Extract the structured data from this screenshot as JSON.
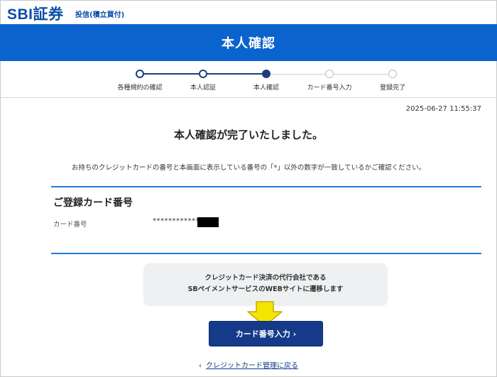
{
  "header": {
    "logo": "SBI証券",
    "subtitle": "投信(積立買付)"
  },
  "page_title": "本人確認",
  "stepper": {
    "steps": [
      {
        "label": "各種規約の確認",
        "state": "done"
      },
      {
        "label": "本人認証",
        "state": "done"
      },
      {
        "label": "本人確認",
        "state": "current"
      },
      {
        "label": "カード番号入力",
        "state": "todo"
      },
      {
        "label": "登録完了",
        "state": "todo"
      }
    ]
  },
  "timestamp": "2025-06-27 11:55:37",
  "main": {
    "heading": "本人確認が完了いたしました。",
    "instruction": "お持ちのクレジットカードの番号と本画面に表示している番号の「*」以外の数字が一致しているかご確認ください。"
  },
  "card": {
    "title": "ご登録カード番号",
    "label": "カード番号",
    "masked_value": "************"
  },
  "notice": {
    "line1": "クレジットカード決済の代行会社である",
    "line2": "SBペイメントサービスのWEBサイトに遷移します"
  },
  "primary_button": {
    "label": "カード番号入力 ›"
  },
  "back_link": {
    "chevron": "‹",
    "label": "クレジットカード管理に戻る"
  },
  "colors": {
    "brand_blue": "#0a4ea8",
    "title_band": "#0b63ce",
    "button": "#163a8a",
    "step_active": "#1c3f7a",
    "divider": "#1e7fd9",
    "arrow": "#f5e400"
  }
}
